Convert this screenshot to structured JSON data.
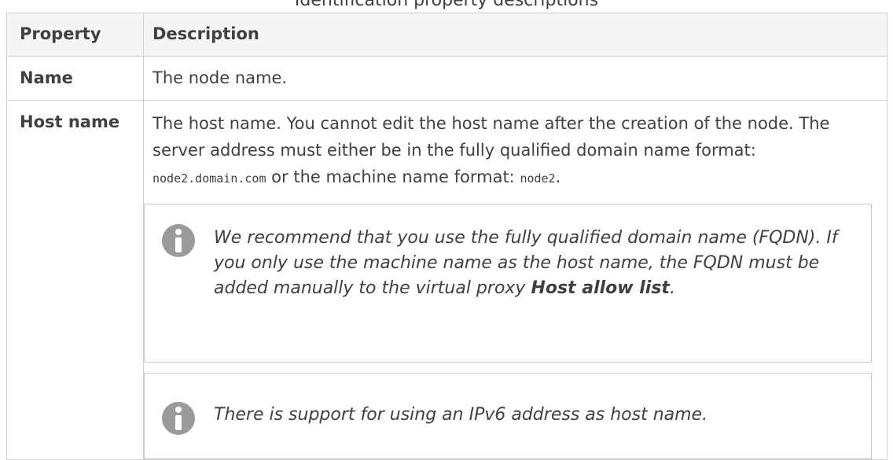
{
  "caption": "Identification property descriptions",
  "table": {
    "header": {
      "property": "Property",
      "description": "Description"
    },
    "rows": [
      {
        "property": "Name",
        "description": "The node name."
      },
      {
        "property": "Host name",
        "description_parts": {
          "text1": "The host name. You cannot edit the host name after the creation of the node. The server address must either be in the fully qualified domain name format: ",
          "code1": "node2.domain.com",
          "text2": " or the machine name format: ",
          "code2": "node2",
          "text3": "."
        },
        "notes": [
          {
            "icon": "info-icon",
            "text1": "We recommend that you use the fully qualified domain name (FQDN). If you only use the machine name as the host name, the FQDN must be added manually to the virtual proxy ",
            "bold": "Host allow list",
            "text2": "."
          },
          {
            "icon": "info-icon",
            "text": "There is support for using an IPv6 address as host name."
          }
        ]
      }
    ]
  },
  "colors": {
    "border": "#d0d0d0",
    "header_bg": "#f5f5f5",
    "text": "#404040",
    "icon": "#9a9a9a"
  }
}
